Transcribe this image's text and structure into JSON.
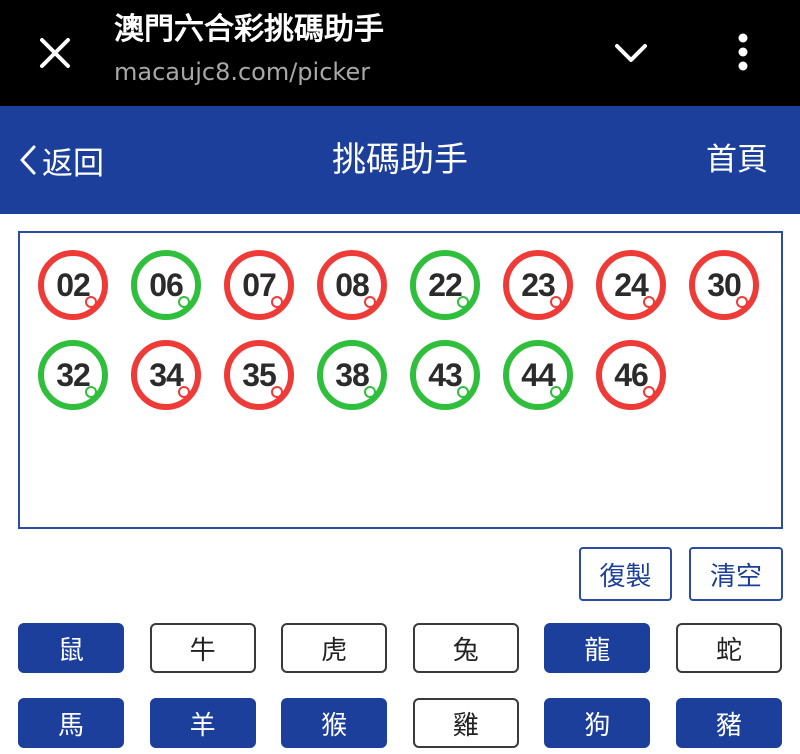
{
  "browser": {
    "title": "澳門六合彩挑碼助手",
    "url": "macaujc8.com/picker",
    "close_icon": "close-icon",
    "chevron_icon": "chevron-down-icon",
    "more_icon": "more-vertical-icon"
  },
  "header": {
    "back_label": "返回",
    "title": "挑碼助手",
    "home_label": "首頁",
    "color": "#1b3f9a"
  },
  "balls": [
    {
      "num": "02",
      "color": "red"
    },
    {
      "num": "06",
      "color": "green"
    },
    {
      "num": "07",
      "color": "red"
    },
    {
      "num": "08",
      "color": "red"
    },
    {
      "num": "22",
      "color": "green"
    },
    {
      "num": "23",
      "color": "red"
    },
    {
      "num": "24",
      "color": "red"
    },
    {
      "num": "30",
      "color": "red"
    },
    {
      "num": "32",
      "color": "green"
    },
    {
      "num": "34",
      "color": "red"
    },
    {
      "num": "35",
      "color": "red"
    },
    {
      "num": "38",
      "color": "green"
    },
    {
      "num": "43",
      "color": "green"
    },
    {
      "num": "44",
      "color": "green"
    },
    {
      "num": "46",
      "color": "red"
    }
  ],
  "ball_colors": {
    "red": "#ef3b37",
    "green": "#2fbf3d"
  },
  "actions": {
    "copy_label": "復製",
    "clear_label": "清空"
  },
  "zodiac": [
    {
      "label": "鼠",
      "selected": true
    },
    {
      "label": "牛",
      "selected": false
    },
    {
      "label": "虎",
      "selected": false
    },
    {
      "label": "兔",
      "selected": false
    },
    {
      "label": "龍",
      "selected": true
    },
    {
      "label": "蛇",
      "selected": false
    },
    {
      "label": "馬",
      "selected": true
    },
    {
      "label": "羊",
      "selected": true
    },
    {
      "label": "猴",
      "selected": true
    },
    {
      "label": "雞",
      "selected": false
    },
    {
      "label": "狗",
      "selected": true
    },
    {
      "label": "豬",
      "selected": true
    }
  ]
}
